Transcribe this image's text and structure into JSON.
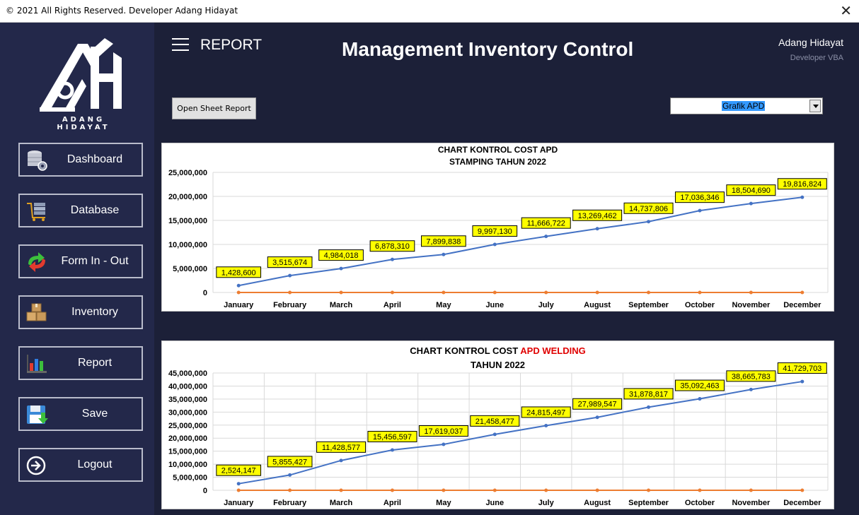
{
  "titlebar": {
    "text": "© 2021 All Rights Reserved. Developer Adang Hidayat",
    "close": "✕"
  },
  "logo": {
    "text": "ADANG HIDAYAT"
  },
  "nav": [
    {
      "label": "Dashboard",
      "icon": "database-gear-icon"
    },
    {
      "label": "Database",
      "icon": "database-cart-icon"
    },
    {
      "label": "Form In - Out",
      "icon": "swap-arrows-icon"
    },
    {
      "label": "Inventory",
      "icon": "boxes-icon"
    },
    {
      "label": "Report",
      "icon": "bar-chart-icon"
    },
    {
      "label": "Save",
      "icon": "floppy-icon"
    },
    {
      "label": "Logout",
      "icon": "logout-icon"
    }
  ],
  "header": {
    "page": "REPORT",
    "title": "Management Inventory Control",
    "user_name": "Adang Hidayat",
    "user_role": "Developer VBA"
  },
  "toolbar": {
    "open_sheet": "Open Sheet Report",
    "combo_value": "Grafik APD"
  },
  "colors": {
    "series": "#4472c4",
    "baseline": "#ed7d31",
    "label_bg": "#ffff00",
    "accent_red": "#e00000"
  },
  "charts": [
    {
      "title_line1": "CHART KONTROL  COST APD",
      "title_line2": "STAMPING TAHUN 2022"
    },
    {
      "title_line1_a": "CHART KONTROL COST ",
      "title_line1_b": "APD WELDING",
      "title_line2": "TAHUN 2022"
    }
  ],
  "chart_data": [
    {
      "type": "line",
      "categories": [
        "January",
        "February",
        "March",
        "April",
        "May",
        "June",
        "July",
        "August",
        "September",
        "October",
        "November",
        "December"
      ],
      "series": [
        {
          "values": [
            1428600,
            3515674,
            4984018,
            6878310,
            7899838,
            9997130,
            11666722,
            13269462,
            14737806,
            17036346,
            18504690,
            19816824
          ]
        },
        {
          "values": [
            0,
            0,
            0,
            0,
            0,
            0,
            0,
            0,
            0,
            0,
            0,
            0
          ]
        }
      ],
      "value_labels": [
        "1,428,600",
        "3,515,674",
        "4,984,018",
        "6,878,310",
        "7,899,838",
        "9,997,130",
        "11,666,722",
        "13,269,462",
        "14,737,806",
        "17,036,346",
        "18,504,690",
        "19,816,824"
      ],
      "y_ticks": [
        "0",
        "5,000,000",
        "10,000,000",
        "15,000,000",
        "20,000,000",
        "25,000,000"
      ],
      "ylim": [
        0,
        25000000
      ],
      "grid": "horizontal"
    },
    {
      "type": "line",
      "categories": [
        "January",
        "February",
        "March",
        "April",
        "May",
        "June",
        "July",
        "August",
        "September",
        "October",
        "November",
        "December"
      ],
      "series": [
        {
          "values": [
            2524147,
            5855427,
            11428577,
            15456597,
            17619037,
            21458477,
            24815497,
            27989547,
            31878817,
            35092463,
            38665783,
            41729703
          ]
        },
        {
          "values": [
            0,
            0,
            0,
            0,
            0,
            0,
            0,
            0,
            0,
            0,
            0,
            0
          ]
        }
      ],
      "value_labels": [
        "2,524,147",
        "5,855,427",
        "11,428,577",
        "15,456,597",
        "17,619,037",
        "21,458,477",
        "24,815,497",
        "27,989,547",
        "31,878,817",
        "35,092,463",
        "38,665,783",
        "41,729,703"
      ],
      "y_ticks": [
        "0",
        "5,000,000",
        "10,000,000",
        "15,000,000",
        "20,000,000",
        "25,000,000",
        "30,000,000",
        "35,000,000",
        "40,000,000",
        "45,000,000"
      ],
      "ylim": [
        0,
        45000000
      ],
      "grid": "both"
    }
  ]
}
